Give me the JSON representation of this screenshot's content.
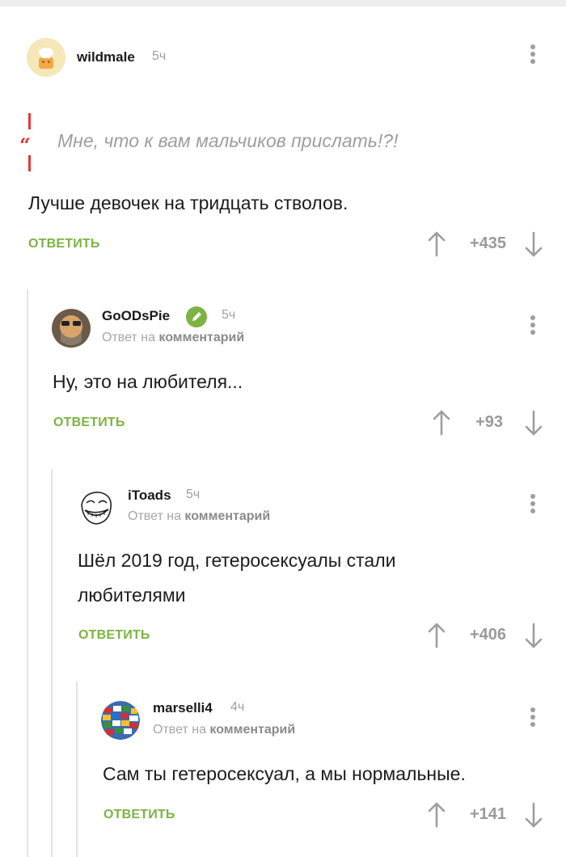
{
  "comments": [
    {
      "username": "wildmale",
      "time": "5ч",
      "quote": "Мне, что к вам мальчиков прислать!?!",
      "text": "Лучше девочек на тридцать стволов.",
      "reply_label": "ОТВЕТИТЬ",
      "score": "+435"
    },
    {
      "username": "GoODsPie",
      "time": "5ч",
      "reply_prefix": "Ответ на",
      "reply_target": "комментарий",
      "text": "Ну, это на любителя...",
      "reply_label": "ОТВЕТИТЬ",
      "score": "+93"
    },
    {
      "username": "iToads",
      "time": "5ч",
      "reply_prefix": "Ответ на",
      "reply_target": "комментарий",
      "text_lines": [
        "Шёл 2019 год, гетеросексуалы стали",
        "любителями"
      ],
      "reply_label": "ОТВЕТИТЬ",
      "score": "+406"
    },
    {
      "username": "marselli4",
      "time": "4ч",
      "reply_prefix": "Ответ на",
      "reply_target": "комментарий",
      "text": "Сам ты гетеросексуал, а мы нормальные.",
      "reply_label": "ОТВЕТИТЬ",
      "score": "+141"
    }
  ],
  "icons": {
    "more": "more-vertical-icon",
    "upvote": "arrow-up-icon",
    "downvote": "arrow-down-icon",
    "quote": "quote-icon",
    "verified": "pencil-icon"
  },
  "colors": {
    "accent_green": "#7cb342",
    "quote_red": "#e53935",
    "muted": "#9e9e9e"
  }
}
